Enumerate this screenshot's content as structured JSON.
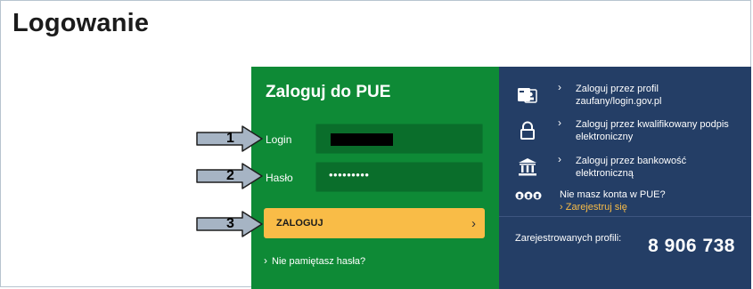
{
  "page": {
    "title": "Logowanie"
  },
  "login": {
    "heading": "Zaloguj do PUE",
    "login_label": "Login",
    "password_label": "Hasło",
    "password_mask": "•••••••••",
    "submit_label": "ZALOGUJ",
    "forgot_label": "Nie pamiętasz hasła?"
  },
  "alt_login": {
    "items": [
      {
        "label": "Zaloguj przez profil zaufany/login.gov.pl"
      },
      {
        "label": "Zaloguj przez kwalifikowany podpis elektroniczny"
      },
      {
        "label": "Zaloguj przez bankowość elektroniczną"
      }
    ],
    "no_account": "Nie masz konta w PUE?",
    "register": "Zarejestruj się",
    "register_color": "#f9bc47"
  },
  "stats": {
    "label": "Zarejestrowanych profili:",
    "value": "8 906 738"
  },
  "steps": [
    "1",
    "2",
    "3"
  ],
  "colors": {
    "green": "#0e8a36",
    "navy": "#243e66",
    "button": "#f9bc47",
    "arrow": "#a6b4c4"
  }
}
